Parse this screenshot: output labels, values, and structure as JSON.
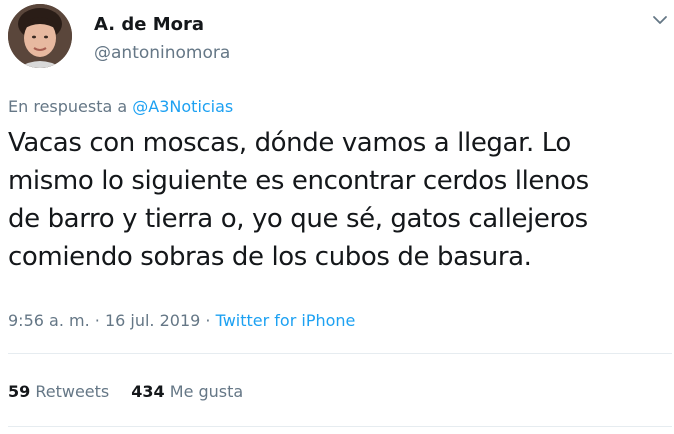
{
  "author": {
    "display_name": "A. de Mora",
    "username": "@antoninomora"
  },
  "reply": {
    "prefix": "En respuesta a",
    "mention": "@A3Noticias"
  },
  "tweet": {
    "lines": [
      "Vacas con moscas, dónde vamos a llegar. Lo",
      "mismo lo siguiente es encontrar cerdos llenos",
      "de barro y tierra o, yo que sé, gatos callejeros",
      "comiendo sobras de los cubos de basura."
    ]
  },
  "meta": {
    "time": "9:56 a. m.",
    "separator1": " · ",
    "date": "16 jul. 2019",
    "separator2": " · ",
    "source": "Twitter for iPhone"
  },
  "stats": {
    "retweets_count": "59",
    "retweets_label": "Retweets",
    "likes_count": "434",
    "likes_label": "Me gusta"
  },
  "icons": {
    "caret": "chevron-down-icon",
    "avatar": "avatar"
  },
  "colors": {
    "link": "#1da1f2",
    "secondary_text": "#657786",
    "primary_text": "#14171a",
    "divider": "#e6ecf0"
  }
}
